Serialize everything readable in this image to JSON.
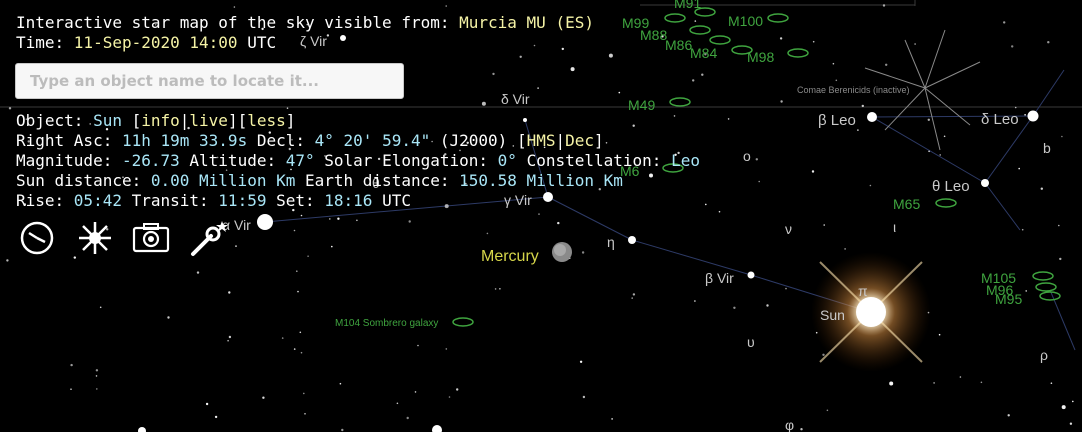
{
  "header": {
    "title_prefix": "Interactive star map of the sky visible from: ",
    "location": "Murcia MU (ES)",
    "time_prefix": "Time: ",
    "time": "11-Sep-2020 14:00",
    "time_suffix": " UTC"
  },
  "search": {
    "placeholder": "Type an object name to locate it..."
  },
  "object": {
    "label": "Object: ",
    "name": "Sun",
    "info_link": "info",
    "live_link": "live",
    "less_link": "less",
    "ra_label": "Right Asc: ",
    "ra": "11h 19m 33.9s",
    "decl_label": " Decl: ",
    "decl": "4° 20' 59.4\"",
    "epoch": " (J2000) ",
    "hms_link": "HMS",
    "dec_link": "Dec",
    "mag_label": "Magnitude: ",
    "magnitude": "-26.73",
    "alt_label": " Altitude: ",
    "altitude": "47°",
    "elong_label": " Solar Elongation: ",
    "elongation": "0°",
    "const_label": " Constellation: ",
    "constellation": "Leo",
    "sun_dist_label": "Sun distance: ",
    "sun_distance": "0.00 Million Km",
    "earth_dist_label": " Earth distance: ",
    "earth_distance": "150.58 Million Km",
    "rise_label": "Rise: ",
    "rise": "05:42",
    "transit_label": " Transit: ",
    "transit": "11:59",
    "set_label": " Set: ",
    "set": "18:16",
    "utc": " UTC"
  },
  "toolbar": {
    "icons": [
      "clock-icon",
      "sun-burst-icon",
      "camera-icon",
      "settings-wrench-icon"
    ]
  },
  "sky_labels": {
    "mercury": "Mercury",
    "sun": "Sun",
    "sombrero": "M104 Sombrero galaxy",
    "comae": "Comae Berenicids (inactive)",
    "m49": "M49",
    "m65": "M65",
    "m105": "M105",
    "m96": "M96",
    "m95": "M95",
    "m61": "M6",
    "m100": "M100",
    "m98": "M98",
    "m99": "M99",
    "m84": "M84",
    "m86": "M86",
    "m91": "M91",
    "m88": "M88",
    "zeta_vir": "ζ Vir",
    "delta_vir": "δ Vir",
    "gamma_vir": "γ Vir",
    "alpha_vir": "α Vir",
    "beta_vir": "β Vir",
    "eta": "η",
    "nu": "ν",
    "upsilon": "υ",
    "iota": "ι",
    "phi": "φ",
    "beta_leo": "β Leo",
    "delta_leo": "δ Leo",
    "theta_leo": "θ Leo",
    "b": "b",
    "rho": "ρ",
    "omicron": "o",
    "pi": "π",
    "theta": "θ"
  },
  "colors": {
    "background": "#000000",
    "highlight": "#f5f3a6",
    "value": "#a9e6f7",
    "dso": "#3fa43f",
    "planet_label": "#d6d64a",
    "star_label": "#c9c9c9",
    "constellation_line": "#2d3a66"
  }
}
